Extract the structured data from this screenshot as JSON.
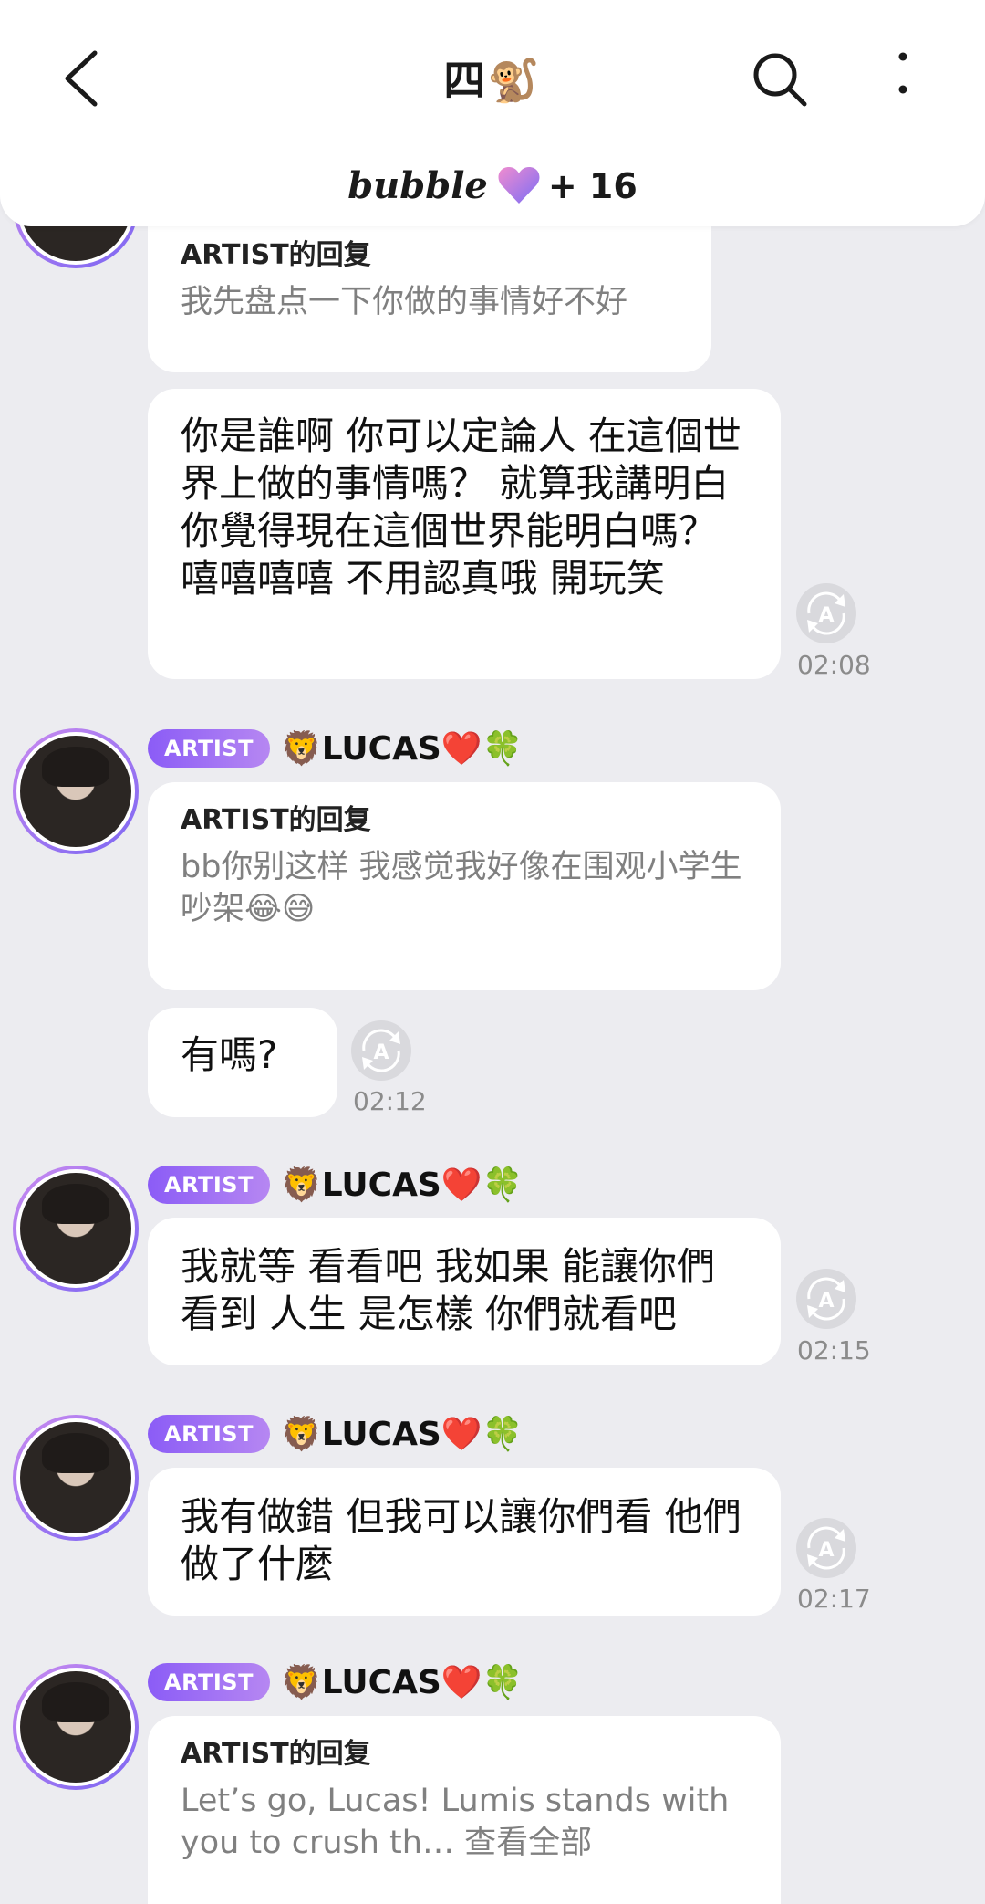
{
  "header": {
    "title": "四🐒",
    "back_icon": "chevron-left-icon",
    "search_icon": "search-icon",
    "more_icon": "more-vertical-icon",
    "brand": "bubble",
    "plus_count": "+ 16",
    "heart_colors": [
      "#9b7cf5",
      "#f08ccf"
    ]
  },
  "messages": [
    {
      "reply_label": "ARTIST的回复",
      "reply_text": "我先盘点一下你做的事情好不好"
    },
    {
      "body": "你是誰啊 你可以定論人 在這個世界上做的事情嗎？ 就算我講明白 你覺得現在這個世界能明白嗎？ 嘻嘻嘻嘻 不用認真哦 開玩笑",
      "time": "02:08"
    },
    {
      "badge": "ARTIST",
      "sender": "🦁LUCAS❤️🍀",
      "reply_label": "ARTIST的回复",
      "reply_text": "bb你别这样 我感觉我好像在围观小学生吵架😂😅"
    },
    {
      "body": "有嗎?",
      "time": "02:12"
    },
    {
      "badge": "ARTIST",
      "sender": "🦁LUCAS❤️🍀",
      "body": "我就等 看看吧 我如果 能讓你們看到 人生 是怎樣 你們就看吧",
      "time": "02:15"
    },
    {
      "badge": "ARTIST",
      "sender": "🦁LUCAS❤️🍀",
      "body": "我有做錯 但我可以讓你們看 他們做了什麼",
      "time": "02:17"
    },
    {
      "badge": "ARTIST",
      "sender": "🦁LUCAS❤️🍀",
      "reply_label": "ARTIST的回复",
      "reply_text": "Let’s go, Lucas! Lumis stands with you to crush th…",
      "see_all": "查看全部"
    }
  ],
  "icons": {
    "translate": "translate-icon",
    "avatar": "avatar"
  },
  "colors": {
    "background": "#ececf0",
    "badge": "#8b5cf6",
    "avatar_ring": "#a57cf2"
  }
}
